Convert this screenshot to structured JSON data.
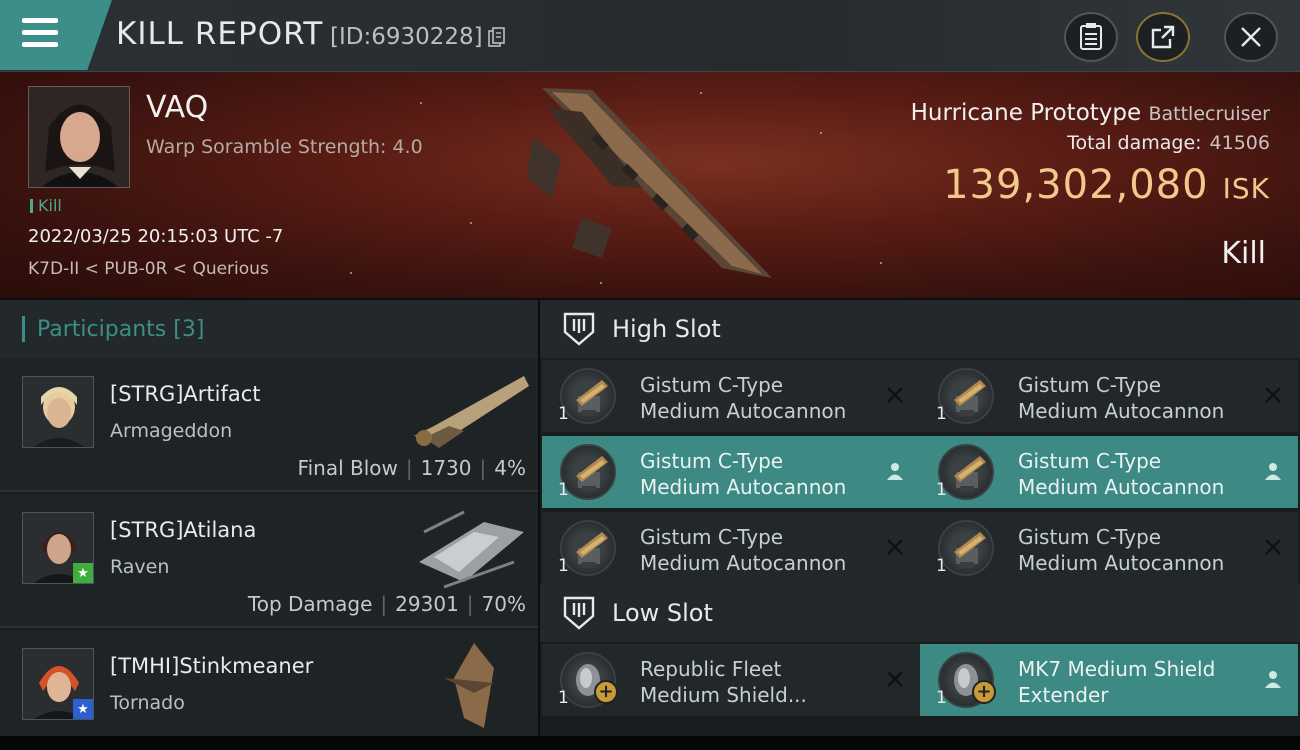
{
  "header": {
    "title": "KILL REPORT",
    "report_id": "[ID:6930228]"
  },
  "victim": {
    "name": "VAQ",
    "warp_scramble": "Warp Soramble Strength: 4.0",
    "tag": "Kill",
    "timestamp": "2022/03/25 20:15:03 UTC -7",
    "location": "K7D-II < PUB-0R < Querious",
    "ship_name": "Hurricane Prototype",
    "ship_class": "Battlecruiser",
    "total_damage_label": "Total damage:",
    "total_damage": "41506",
    "isk_value": "139,302,080",
    "isk_unit": "ISK",
    "result": "Kill"
  },
  "participants": {
    "title": "Participants",
    "count": "[3]",
    "items": [
      {
        "name": "[STRG]Artifact",
        "ship": "Armageddon",
        "role": "Final Blow",
        "damage": "1730",
        "percent": "4%"
      },
      {
        "name": "[STRG]Atilana",
        "ship": "Raven",
        "role": "Top Damage",
        "damage": "29301",
        "percent": "70%"
      },
      {
        "name": "[TMHI]Stinkmeaner",
        "ship": "Tornado",
        "role": "",
        "damage": "",
        "percent": ""
      }
    ]
  },
  "high_slot": {
    "label": "High Slot",
    "items": [
      {
        "line1": "Gistum C-Type",
        "line2": "Medium Autocannon",
        "qty": "1",
        "status": "destroyed"
      },
      {
        "line1": "Gistum C-Type",
        "line2": "Medium Autocannon",
        "qty": "1",
        "status": "destroyed"
      },
      {
        "line1": "Gistum C-Type",
        "line2": "Medium Autocannon",
        "qty": "1",
        "status": "dropped"
      },
      {
        "line1": "Gistum C-Type",
        "line2": "Medium Autocannon",
        "qty": "1",
        "status": "dropped"
      },
      {
        "line1": "Gistum C-Type",
        "line2": "Medium Autocannon",
        "qty": "1",
        "status": "destroyed"
      },
      {
        "line1": "Gistum C-Type",
        "line2": "Medium Autocannon",
        "qty": "1",
        "status": "destroyed"
      }
    ]
  },
  "low_slot": {
    "label": "Low Slot",
    "items": [
      {
        "line1": "Republic Fleet",
        "line2": "Medium Shield...",
        "qty": "1",
        "status": "destroyed"
      },
      {
        "line1": "MK7 Medium Shield",
        "line2": "Extender",
        "qty": "1",
        "status": "dropped"
      }
    ]
  },
  "colors": {
    "accent": "#3b8f88",
    "isk": "#f2c98a",
    "banner": "#5a1d15"
  }
}
